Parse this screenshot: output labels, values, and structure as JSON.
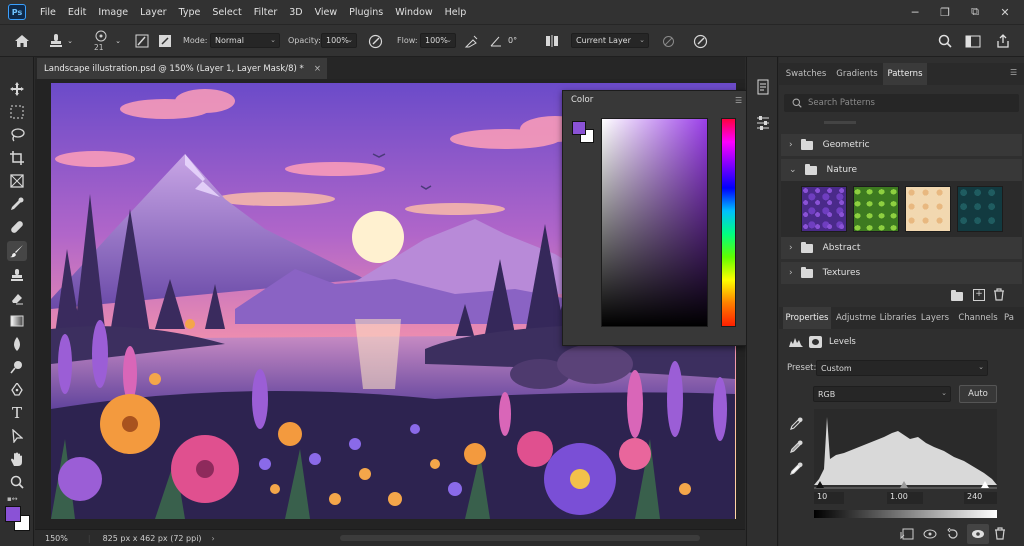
{
  "app": {
    "logo": "Ps"
  },
  "menu": [
    "File",
    "Edit",
    "Image",
    "Layer",
    "Type",
    "Select",
    "Filter",
    "3D",
    "View",
    "Plugins",
    "Window",
    "Help"
  ],
  "window_controls": {
    "minimize_icon": "minimize-icon",
    "restore_icon": "restore-icon",
    "close_icon": "close-icon"
  },
  "options": {
    "brush_size": "21",
    "mode_label": "Mode:",
    "mode_value": "Normal",
    "opacity_label": "Opacity:",
    "opacity_value": "100%",
    "flow_label": "Flow:",
    "flow_value": "100%",
    "angle_value": "0°",
    "sample_value": "Current Layer"
  },
  "document": {
    "tab_title": "Landscape illustration.psd @ 150% (Layer 1, Layer Mask/8) *",
    "close": "×",
    "zoom": "150%",
    "dimensions": "825 px x 462 px (72 ppi)"
  },
  "color_panel": {
    "title": "Color",
    "foreground": "#8a52d6",
    "background": "#ffffff"
  },
  "right_tabs": [
    "Swatches",
    "Gradients",
    "Patterns"
  ],
  "patterns": {
    "search_placeholder": "Search Patterns",
    "groups": [
      {
        "label": "Geometric",
        "expanded": false
      },
      {
        "label": "Nature",
        "expanded": true
      },
      {
        "label": "Abstract",
        "expanded": false
      },
      {
        "label": "Textures",
        "expanded": false
      }
    ]
  },
  "props_tabs": [
    "Properties",
    "Adjustme",
    "Libraries",
    "Layers",
    "Channels",
    "Pa"
  ],
  "properties": {
    "adjustment": "Levels",
    "preset_label": "Preset:",
    "preset_value": "Custom",
    "channel_value": "RGB",
    "auto_label": "Auto",
    "input_black": "10",
    "input_gamma": "1.00",
    "input_white": "240"
  },
  "colors": {
    "accent": "#8a52d6",
    "panel": "#2f2f2f",
    "menubar": "#323232"
  }
}
